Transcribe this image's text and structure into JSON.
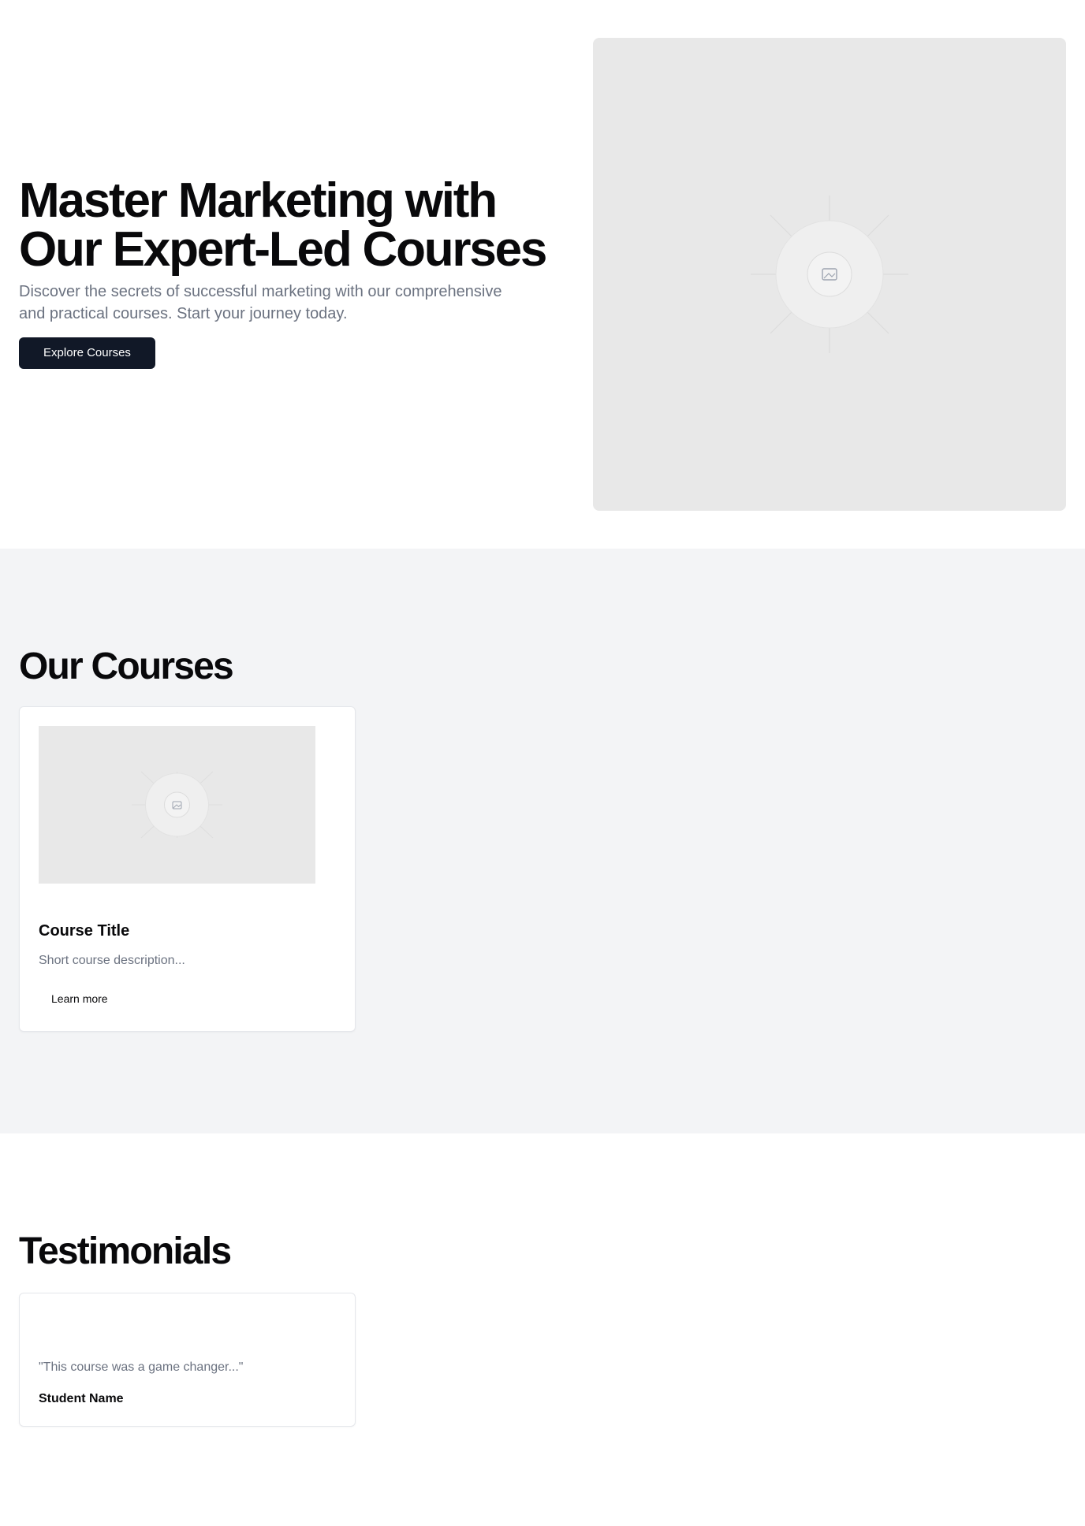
{
  "hero": {
    "title_line1": "Master Marketing with",
    "title_line2": "Our Expert-Led Courses",
    "subtitle": "Discover the secrets of successful marketing with our comprehensive and practical courses. Start your journey today.",
    "cta_label": "Explore Courses",
    "image_icon": "image-placeholder-icon"
  },
  "courses": {
    "heading": "Our Courses",
    "items": [
      {
        "title": "Course Title",
        "description": "Short course description...",
        "link_label": "Learn more",
        "image_icon": "image-placeholder-icon"
      }
    ]
  },
  "testimonials": {
    "heading": "Testimonials",
    "items": [
      {
        "quote": "\"This course was a game changer...\"",
        "name": "Student Name"
      }
    ]
  },
  "colors": {
    "page_bg": "#ffffff",
    "section_alt_bg": "#f3f4f6",
    "primary_button": "#111827",
    "muted_text": "#6b7280",
    "placeholder_bg": "#e8e8e8"
  }
}
